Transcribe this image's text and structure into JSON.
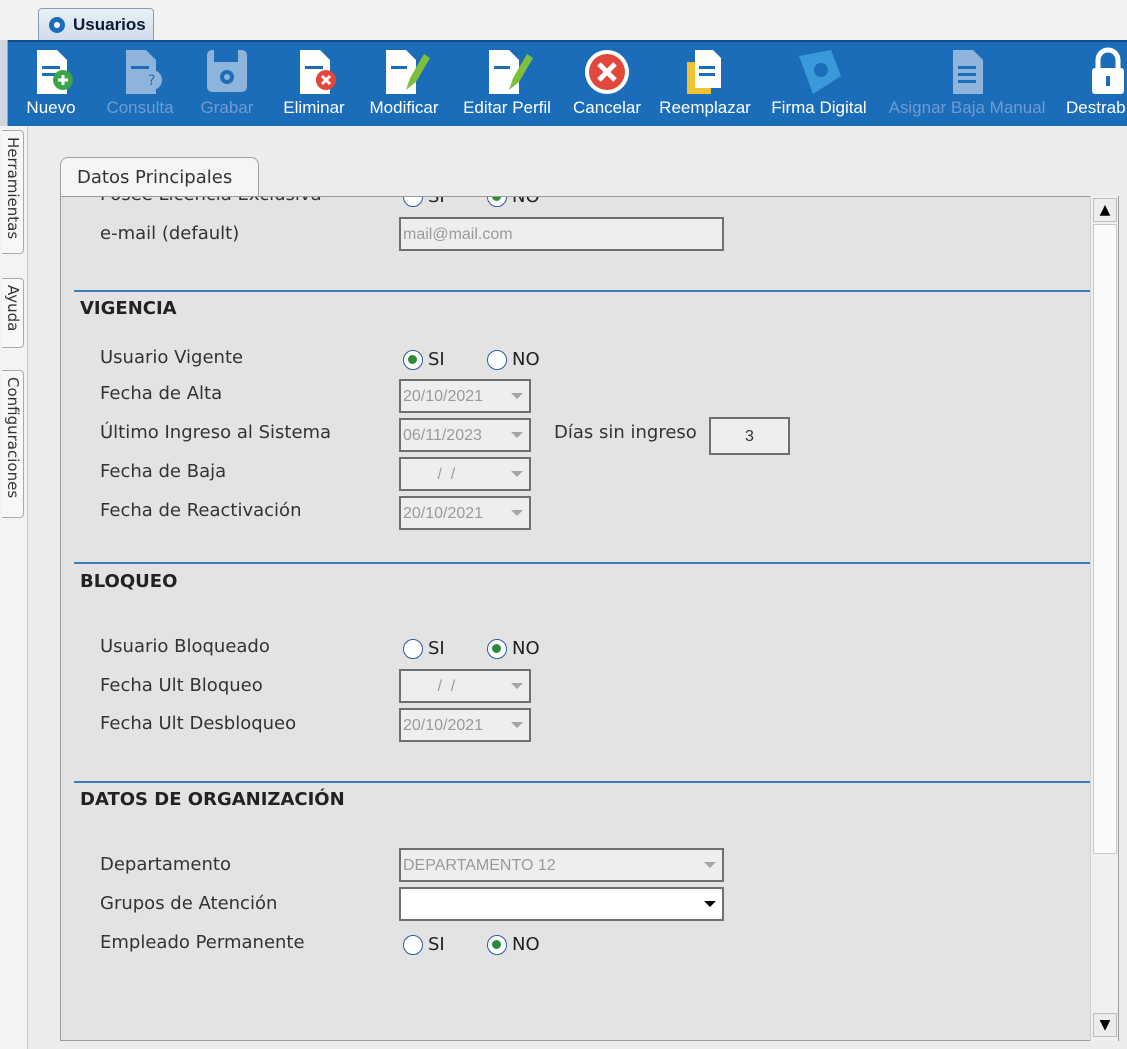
{
  "window_tab": {
    "label": "Usuarios"
  },
  "toolbar": [
    {
      "label": "Nuevo",
      "icon": "new-document-icon",
      "enabled": true
    },
    {
      "label": "Consulta",
      "icon": "query-document-icon",
      "enabled": false
    },
    {
      "label": "Grabar",
      "icon": "save-disk-icon",
      "enabled": false
    },
    {
      "label": "Eliminar",
      "icon": "delete-document-icon",
      "enabled": true
    },
    {
      "label": "Modificar",
      "icon": "edit-document-icon",
      "enabled": true
    },
    {
      "label": "Editar Perfil",
      "icon": "edit-profile-icon",
      "enabled": true
    },
    {
      "label": "Cancelar",
      "icon": "cancel-icon",
      "enabled": true
    },
    {
      "label": "Reemplazar",
      "icon": "replace-document-icon",
      "enabled": true
    },
    {
      "label": "Firma Digital",
      "icon": "digital-signature-icon",
      "enabled": true
    },
    {
      "label": "Asignar Baja Manual",
      "icon": "assign-document-icon",
      "enabled": false
    },
    {
      "label": "Destrab",
      "icon": "unlock-icon",
      "enabled": true
    }
  ],
  "side_tabs": [
    "Herramientas",
    "Ayuda",
    "Configuraciones"
  ],
  "panel_tab": "Datos Principales",
  "top_fields": {
    "licencia_label": "Posee Licencia Exclusiva",
    "licencia_si": "SI",
    "licencia_no": "NO",
    "email_label": "e-mail (default)",
    "email_value": "mail@mail.com"
  },
  "vigencia": {
    "title": "VIGENCIA",
    "usuario_vigente_label": "Usuario Vigente",
    "si": "SI",
    "no": "NO",
    "fecha_alta_label": "Fecha de Alta",
    "fecha_alta": "20/10/2021",
    "ultimo_ingreso_label": "Último Ingreso al Sistema",
    "ultimo_ingreso": "06/11/2023",
    "dias_label": "Días sin ingreso",
    "dias_value": "3",
    "fecha_baja_label": "Fecha de Baja",
    "fecha_baja": " /  /",
    "fecha_reactivacion_label": "Fecha de Reactivación",
    "fecha_reactivacion": "20/10/2021"
  },
  "bloqueo": {
    "title": "BLOQUEO",
    "usuario_bloqueado_label": "Usuario Bloqueado",
    "si": "SI",
    "no": "NO",
    "fecha_ult_bloqueo_label": "Fecha Ult Bloqueo",
    "fecha_ult_bloqueo": " /  /",
    "fecha_ult_desbloqueo_label": "Fecha Ult Desbloqueo",
    "fecha_ult_desbloqueo": "20/10/2021"
  },
  "organizacion": {
    "title": "DATOS DE ORGANIZACIÓN",
    "departamento_label": "Departamento",
    "departamento": "DEPARTAMENTO 12",
    "grupos_label": "Grupos de Atención",
    "grupos": "",
    "empleado_label": "Empleado Permanente",
    "si": "SI",
    "no": "NO"
  },
  "radio_state": {
    "licencia": "NO",
    "vigente": "SI",
    "bloqueado": "NO",
    "permanente": "NO"
  },
  "colors": {
    "toolbar": "#1b6db9",
    "section_line": "#3c7dbb",
    "radio_dot": "#2c8a3c"
  }
}
